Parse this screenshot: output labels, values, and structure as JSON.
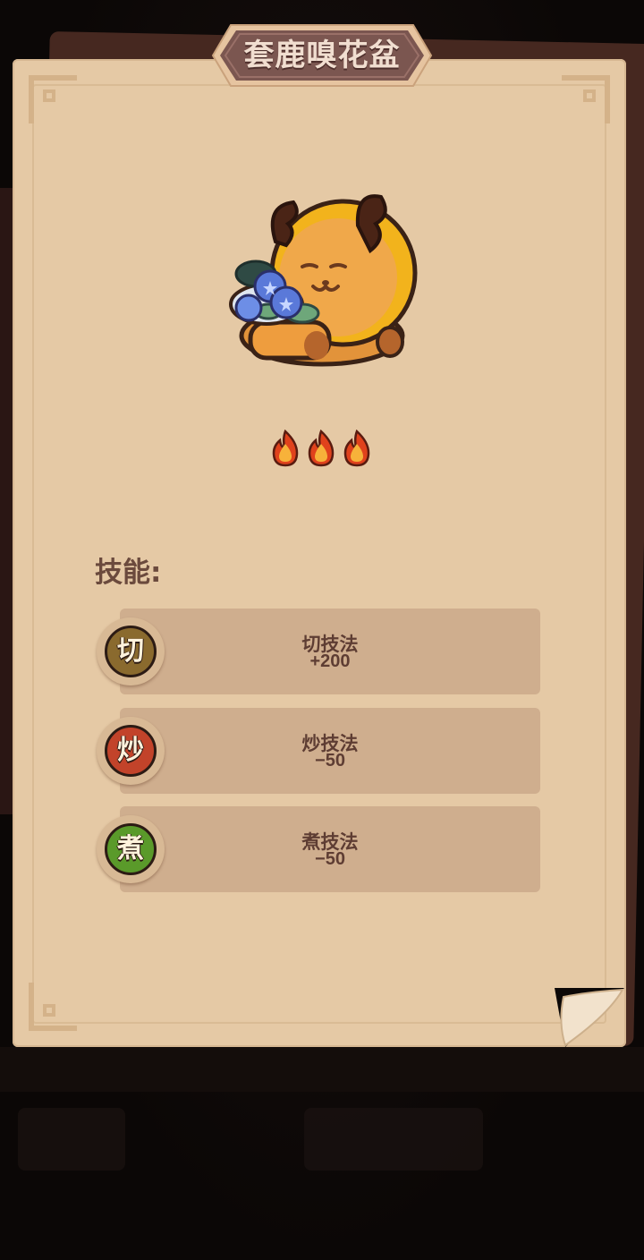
{
  "title": "套鹿嗅花盆",
  "rating": {
    "flames": 3,
    "flame_icon": "flame-icon"
  },
  "skills_label": "技能:",
  "skills": [
    {
      "badge": "切",
      "name": "切技法",
      "value": "+200",
      "color": "#8a6a2e"
    },
    {
      "badge": "炒",
      "name": "炒技法",
      "value": "−50",
      "color": "#c2432a"
    },
    {
      "badge": "煮",
      "name": "煮技法",
      "value": "−50",
      "color": "#5a9a2a"
    }
  ],
  "colors": {
    "parchment": "#e5c9a5",
    "skill_bar": "#cfae8e",
    "title_plaque": "#7b5650",
    "text": "#5e3d33"
  }
}
